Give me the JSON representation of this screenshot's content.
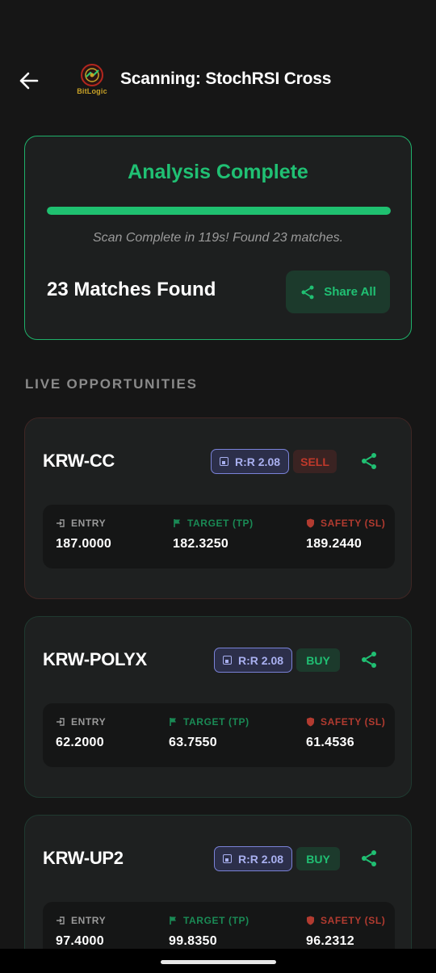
{
  "header": {
    "title": "Scanning: StochRSI Cross",
    "logo_text": "BitLogic",
    "back_icon": "arrow-left-icon"
  },
  "analysis": {
    "title": "Analysis Complete",
    "progress_fraction": 1.0,
    "status": "Scan Complete in 119s! Found 23 matches.",
    "matches_text": "23 Matches Found",
    "share_all_label": "Share All",
    "accent_color": "#20c073"
  },
  "section": {
    "label": "LIVE OPPORTUNITIES"
  },
  "labels": {
    "entry": "ENTRY",
    "target": "TARGET (TP)",
    "safety": "SAFETY (SL)"
  },
  "opportunities": [
    {
      "symbol": "KRW-CC",
      "rr": "R:R 2.08",
      "side": "SELL",
      "entry": "187.0000",
      "target": "182.3250",
      "safety": "189.2440"
    },
    {
      "symbol": "KRW-POLYX",
      "rr": "R:R 2.08",
      "side": "BUY",
      "entry": "62.2000",
      "target": "63.7550",
      "safety": "61.4536"
    },
    {
      "symbol": "KRW-UP2",
      "rr": "R:R 2.08",
      "side": "BUY",
      "entry": "97.4000",
      "target": "99.8350",
      "safety": "96.2312"
    }
  ],
  "colors": {
    "background": "#161616",
    "card": "#1e2020",
    "buy": "#20c073",
    "sell": "#c0392b",
    "rr_badge": "#a9b0f0"
  }
}
